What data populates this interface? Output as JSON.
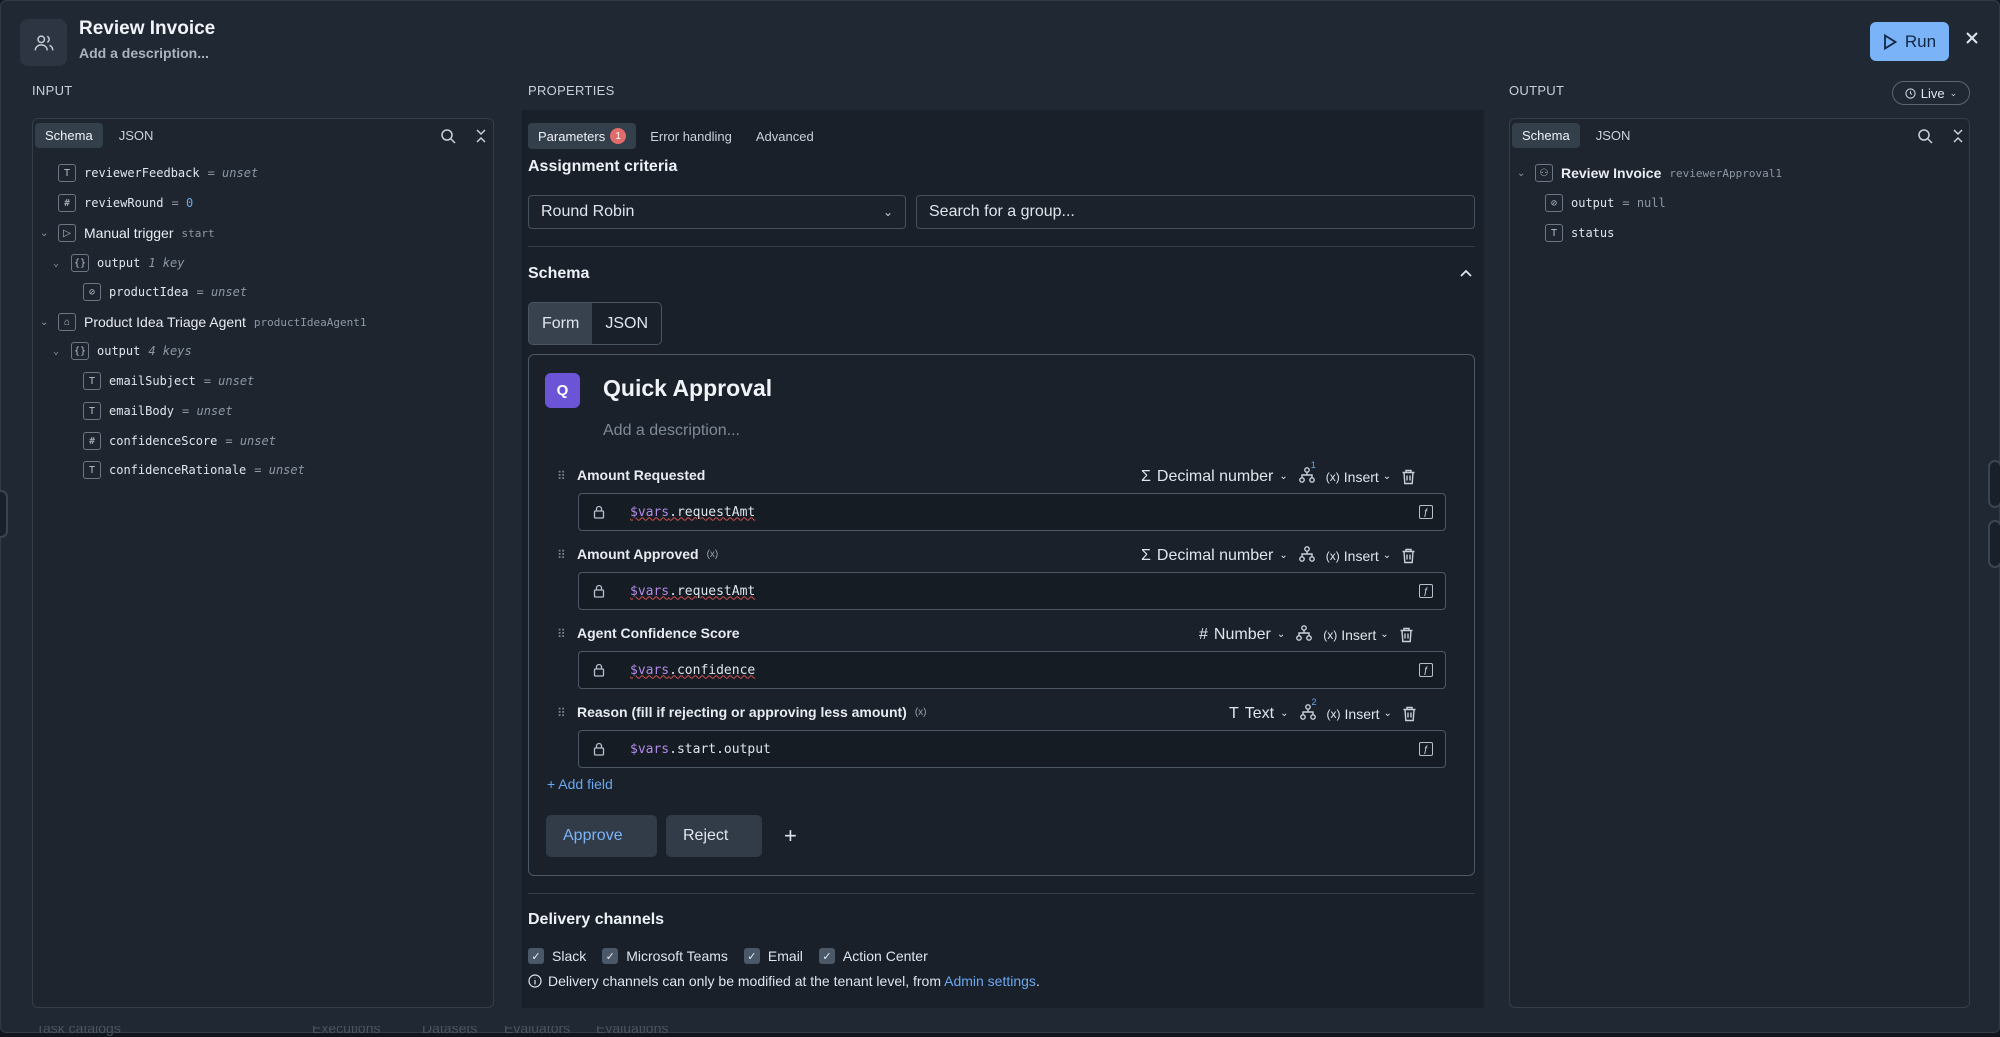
{
  "header": {
    "title": "Review Invoice",
    "description": "Add a description...",
    "run_label": "Run"
  },
  "input": {
    "section_label": "INPUT",
    "tabs": [
      "Schema",
      "JSON"
    ],
    "rows": [
      {
        "key": "reviewerFeedback",
        "eq": "= ",
        "val": "unset"
      },
      {
        "key": "reviewRound",
        "eq": "= ",
        "val": "0"
      },
      {
        "key": "Manual trigger",
        "sub": "start"
      },
      {
        "key": "output",
        "sub": "1 key"
      },
      {
        "key": "productIdea",
        "eq": "= ",
        "val": "unset"
      },
      {
        "key": "Product Idea Triage Agent",
        "sub": "productIdeaAgent1"
      },
      {
        "key": "output",
        "sub": "4 keys"
      },
      {
        "key": "emailSubject",
        "eq": "= ",
        "val": "unset"
      },
      {
        "key": "emailBody",
        "eq": "= ",
        "val": "unset"
      },
      {
        "key": "confidenceScore",
        "eq": "= ",
        "val": "unset"
      },
      {
        "key": "confidenceRationale",
        "eq": "= ",
        "val": "unset"
      }
    ]
  },
  "properties": {
    "section_label": "PROPERTIES",
    "tabs": [
      {
        "label": "Parameters",
        "badge": "1"
      },
      {
        "label": "Error handling"
      },
      {
        "label": "Advanced"
      }
    ],
    "assignment_title": "Assignment criteria",
    "assignment_value": "Round Robin",
    "group_placeholder": "Search for a group...",
    "schema_title": "Schema",
    "schema_tabs": [
      "Form",
      "JSON"
    ],
    "form": {
      "avatar": "Q",
      "title": "Quick Approval",
      "description_placeholder": "Add a description...",
      "fields": [
        {
          "label": "Amount Requested",
          "type_icon": "Σ",
          "type": "Decimal number",
          "var": "$vars",
          "path": ".requestAmt",
          "insert": "Insert",
          "count": "1"
        },
        {
          "label": "Amount Approved",
          "type_icon": "Σ",
          "type": "Decimal number",
          "var": "$vars",
          "path": ".requestAmt",
          "insert": "Insert",
          "count": ""
        },
        {
          "label": "Agent Confidence Score",
          "type_icon": "#",
          "type": "Number",
          "var": "$vars",
          "path": ".confidence",
          "insert": "Insert",
          "count": ""
        },
        {
          "label": "Reason (fill if rejecting or approving less amount)",
          "type_icon": "T",
          "type": "Text",
          "var": "$vars",
          "path": ".start.output",
          "insert": "Insert",
          "count": "2"
        }
      ],
      "add_field": "+ Add field",
      "approve": "Approve",
      "reject": "Reject",
      "add_action": "+"
    },
    "delivery_title": "Delivery channels",
    "channels": [
      "Slack",
      "Microsoft Teams",
      "Email",
      "Action Center"
    ],
    "info_text": "Delivery channels can only be modified at the tenant level, from ",
    "info_link": "Admin settings",
    "info_end": "."
  },
  "output": {
    "section_label": "OUTPUT",
    "live_label": "Live",
    "tabs": [
      "Schema",
      "JSON"
    ],
    "rows": [
      {
        "key": "Review Invoice",
        "sub": "reviewerApproval1"
      },
      {
        "key": "output",
        "eq": "= ",
        "val": "null"
      },
      {
        "key": "status"
      }
    ]
  },
  "background": {
    "ghost_text": [
      "Task catalogs",
      "Executions",
      "Datasets",
      "Evaluators",
      "Evaluations"
    ]
  },
  "colors": {
    "accent": "#7ab3f7",
    "link": "#6aa8f0",
    "badge": "#e06c6c",
    "avatar": "#6b55d6"
  }
}
